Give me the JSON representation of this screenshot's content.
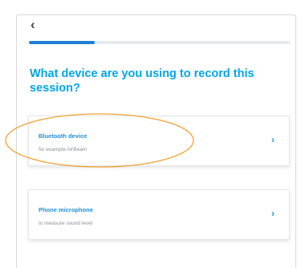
{
  "nav": {
    "back_icon": "chevron-left-icon",
    "back_glyph": "‹"
  },
  "progress": {
    "fraction": 0.25,
    "color": "#1e7fd6"
  },
  "question": "What device are you using to record this session?",
  "options": [
    {
      "title": "Bluetooth device",
      "subtitle": "for example AirBeam",
      "chevron": "›"
    },
    {
      "title": "Phone microphone",
      "subtitle": "to measure sound level",
      "chevron": "›"
    }
  ],
  "colors": {
    "accent": "#00a6e6",
    "card_title": "#1f8fd8",
    "annotation": "#f0a030"
  }
}
